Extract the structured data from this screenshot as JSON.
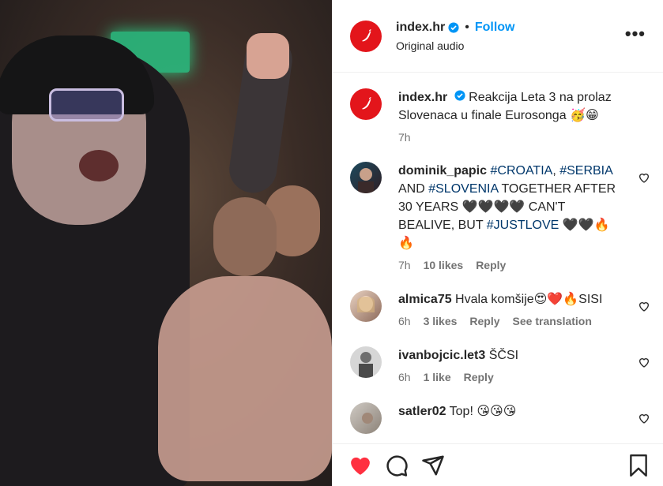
{
  "post": {
    "username": "index.hr",
    "follow_label": "Follow",
    "dot": "•",
    "subtitle": "Original audio",
    "more_label": "•••"
  },
  "caption": {
    "username": "index.hr",
    "text": " Reakcija Leta 3 na prolaz Slovenaca u finale Eurosonga 🥳😁",
    "time": "7h"
  },
  "comments": [
    {
      "username": "dominik_papic",
      "parts": [
        {
          "t": " ",
          "tag": false
        },
        {
          "t": "#CROATIA",
          "tag": true
        },
        {
          "t": ", ",
          "tag": false
        },
        {
          "t": "#SERBIA",
          "tag": true
        },
        {
          "t": " AND ",
          "tag": false
        },
        {
          "t": "#SLOVENIA",
          "tag": true
        },
        {
          "t": " TOGETHER AFTER 30 YEARS 🖤🖤🖤🖤 CAN'T BEALIVE, BUT ",
          "tag": false
        },
        {
          "t": "#JUSTLOVE",
          "tag": true
        },
        {
          "t": " 🖤🖤🔥🔥",
          "tag": false
        }
      ],
      "time": "7h",
      "likes": "10 likes",
      "reply": "Reply",
      "extra": ""
    },
    {
      "username": "almica75",
      "parts": [
        {
          "t": " Hvala komšije😍❤️🔥SISI",
          "tag": false
        }
      ],
      "time": "6h",
      "likes": "3 likes",
      "reply": "Reply",
      "extra": "See translation"
    },
    {
      "username": "ivanbojcic.let3",
      "parts": [
        {
          "t": " ŠČSI",
          "tag": false
        }
      ],
      "time": "6h",
      "likes": "1 like",
      "reply": "Reply",
      "extra": ""
    },
    {
      "username": "satler02",
      "parts": [
        {
          "t": " Top! 😘😘😘",
          "tag": false
        }
      ],
      "time": "",
      "likes": "",
      "reply": "",
      "extra": ""
    }
  ],
  "colors": {
    "brand_red": "#e3151b",
    "link_blue": "#0095f6",
    "hashtag": "#00376b",
    "like_red": "#ff3040"
  },
  "icons": [
    "heart-icon",
    "comment-icon",
    "share-icon",
    "bookmark-icon",
    "verified-icon",
    "more-icon",
    "chili-logo-icon"
  ]
}
